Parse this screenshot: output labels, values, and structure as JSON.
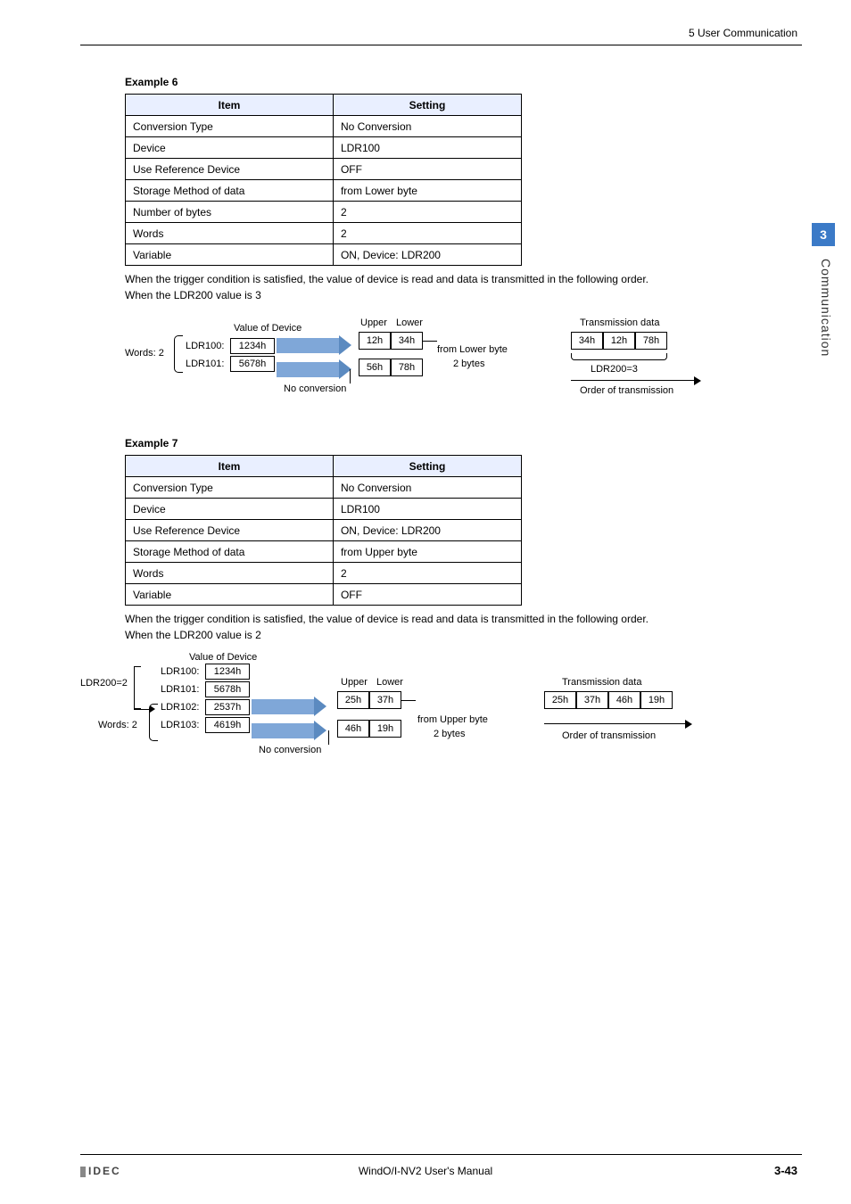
{
  "header": {
    "section": "5 User Communication"
  },
  "sidetab": {
    "num": "3",
    "label": "Communication"
  },
  "example6": {
    "title": "Example 6",
    "headers": {
      "item": "Item",
      "setting": "Setting"
    },
    "rows": [
      {
        "item": "Conversion Type",
        "setting": "No Conversion"
      },
      {
        "item": "Device",
        "setting": "LDR100"
      },
      {
        "item": "Use Reference Device",
        "setting": "OFF"
      },
      {
        "item": "Storage Method of data",
        "setting": "from Lower byte"
      },
      {
        "item": "Number of bytes",
        "setting": "2"
      },
      {
        "item": "Words",
        "setting": "2"
      },
      {
        "item": "Variable",
        "setting": "ON, Device: LDR200"
      }
    ],
    "note1": "When the trigger condition is satisfied, the value of device is read and data is transmitted in the following order.",
    "note2": "When the LDR200 value is 3",
    "diagram": {
      "words_lbl": "Words: 2",
      "valdev": "Value of Device",
      "ldr100": "LDR100:",
      "ldr101": "LDR101:",
      "v1": "1234h",
      "v2": "5678h",
      "noconv": "No conversion",
      "upper": "Upper",
      "lower": "Lower",
      "b1": "12h",
      "b2": "34h",
      "b3": "56h",
      "b4": "78h",
      "from1": "from Lower byte",
      "from2": "2 bytes",
      "trans": "Transmission data",
      "t1": "34h",
      "t2": "12h",
      "t3": "78h",
      "ldr200": "LDR200=3",
      "order": "Order of transmission"
    }
  },
  "example7": {
    "title": "Example 7",
    "headers": {
      "item": "Item",
      "setting": "Setting"
    },
    "rows": [
      {
        "item": "Conversion Type",
        "setting": "No Conversion"
      },
      {
        "item": "Device",
        "setting": "LDR100"
      },
      {
        "item": "Use Reference Device",
        "setting": "ON, Device: LDR200"
      },
      {
        "item": "Storage Method of data",
        "setting": "from Upper byte"
      },
      {
        "item": "Words",
        "setting": "2"
      },
      {
        "item": "Variable",
        "setting": "OFF"
      }
    ],
    "note1": "When the trigger condition is satisfied, the value of device is read and data is transmitted in the following order.",
    "note2": "When the LDR200 value is 2",
    "diagram": {
      "ldr200eq": "LDR200=2",
      "words_lbl": "Words: 2",
      "valdev": "Value of Device",
      "ldr100": "LDR100:",
      "ldr101": "LDR101:",
      "ldr102": "LDR102:",
      "ldr103": "LDR103:",
      "v1": "1234h",
      "v2": "5678h",
      "v3": "2537h",
      "v4": "4619h",
      "noconv": "No conversion",
      "upper": "Upper",
      "lower": "Lower",
      "b1": "25h",
      "b2": "37h",
      "b3": "46h",
      "b4": "19h",
      "from1": "from Upper byte",
      "from2": "2 bytes",
      "trans": "Transmission data",
      "t1": "25h",
      "t2": "37h",
      "t3": "46h",
      "t4": "19h",
      "order": "Order of transmission"
    }
  },
  "footer": {
    "brand": "IDEC",
    "center": "WindO/I-NV2 User's Manual",
    "page": "3-43"
  }
}
